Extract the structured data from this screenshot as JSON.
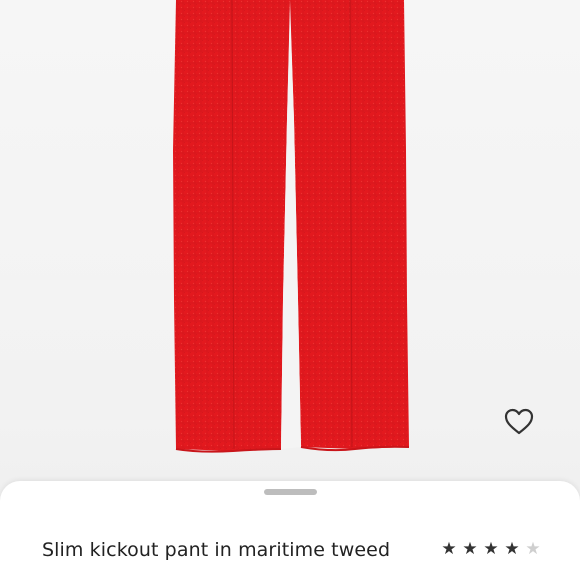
{
  "product": {
    "title": "Slim kickout pant in maritime tweed",
    "rating": 4,
    "rating_max": 5,
    "color": "#e01b1f"
  },
  "icons": {
    "wishlist": "heart-outline-icon",
    "star_filled": "★",
    "star_empty": "★"
  },
  "colors": {
    "star_filled": "#333333",
    "star_empty": "#cfcfcf"
  }
}
